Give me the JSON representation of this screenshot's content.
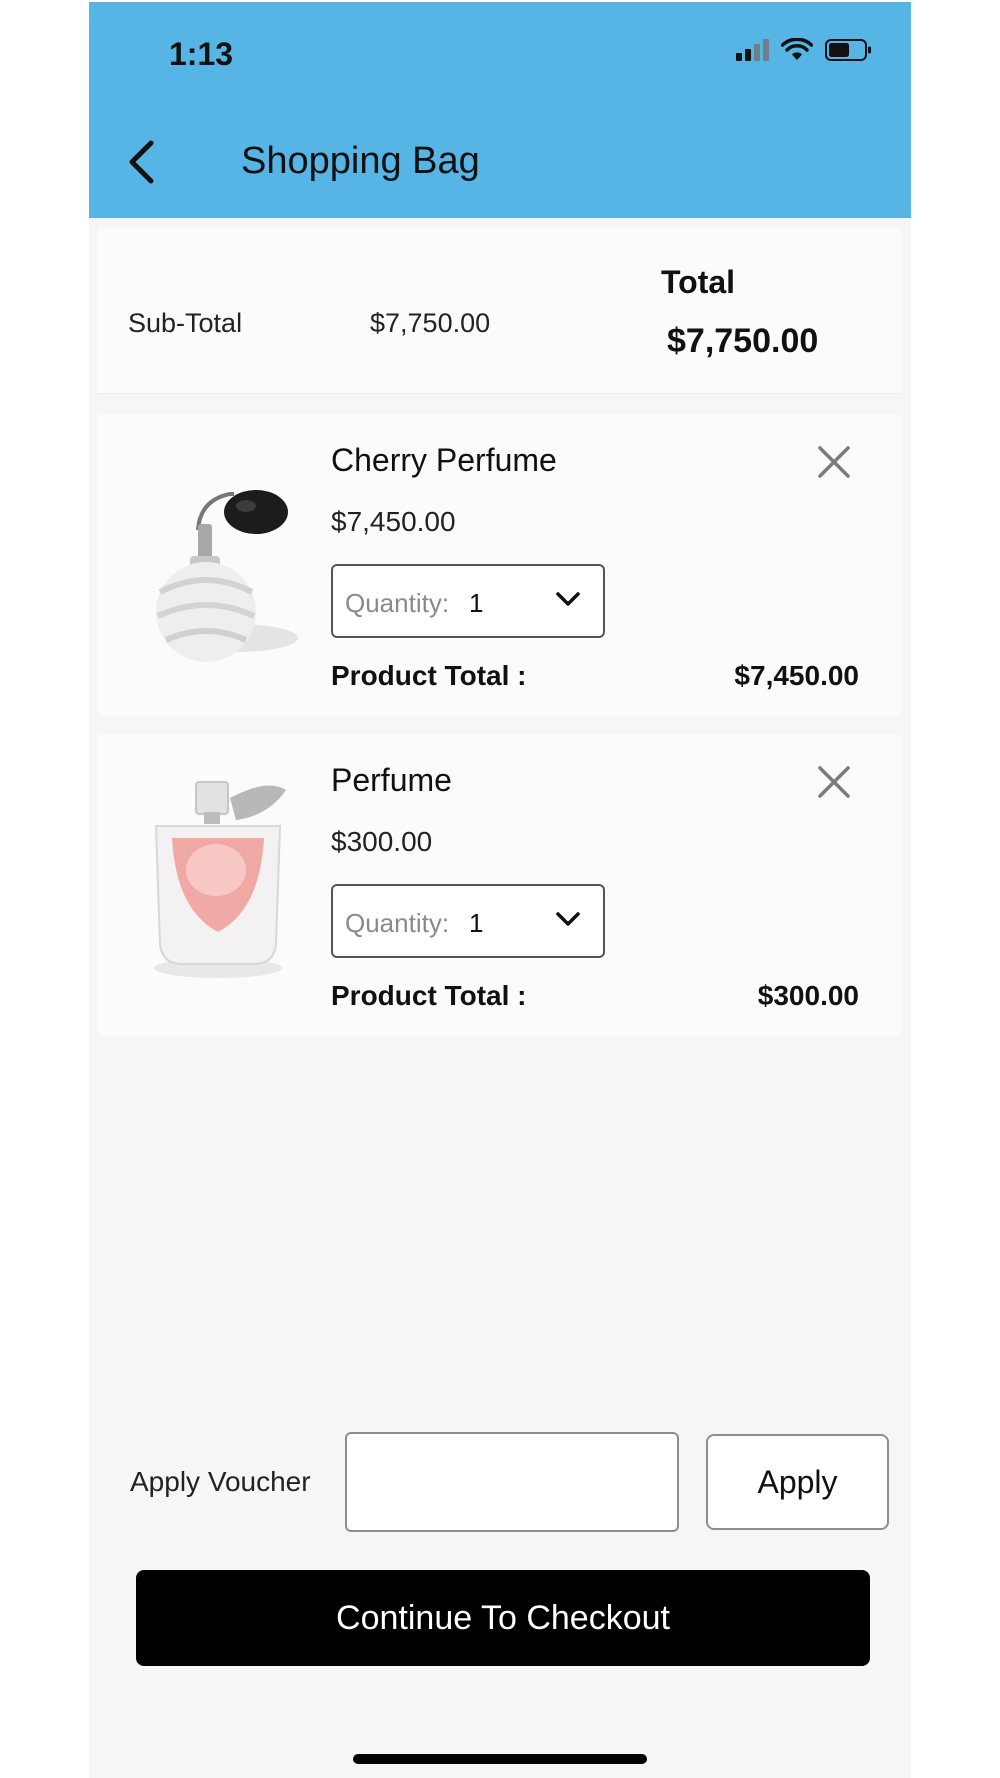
{
  "status_bar": {
    "time": "1:13"
  },
  "header": {
    "title": "Shopping Bag"
  },
  "summary": {
    "subtotal_label": "Sub-Total",
    "subtotal_value": "$7,750.00",
    "total_label": "Total",
    "total_value": "$7,750.00"
  },
  "products": [
    {
      "name": "Cherry Perfume",
      "price": "$7,450.00",
      "quantity_label": "Quantity:",
      "quantity_value": "1",
      "total_label": "Product Total :",
      "total_value": "$7,450.00",
      "image_icon": "atomizer-perfume-bottle"
    },
    {
      "name": "Perfume",
      "price": "$300.00",
      "quantity_label": "Quantity:",
      "quantity_value": "1",
      "total_label": "Product Total :",
      "total_value": "$300.00",
      "image_icon": "pink-perfume-bottle"
    }
  ],
  "voucher": {
    "label": "Apply Voucher",
    "input_value": "",
    "apply_label": "Apply"
  },
  "checkout": {
    "label": "Continue To Checkout"
  },
  "colors": {
    "header_bg": "#56b5e5",
    "page_bg": "#f6f6f6",
    "card_bg": "#fbfbfb",
    "checkout_bg": "#000000"
  }
}
